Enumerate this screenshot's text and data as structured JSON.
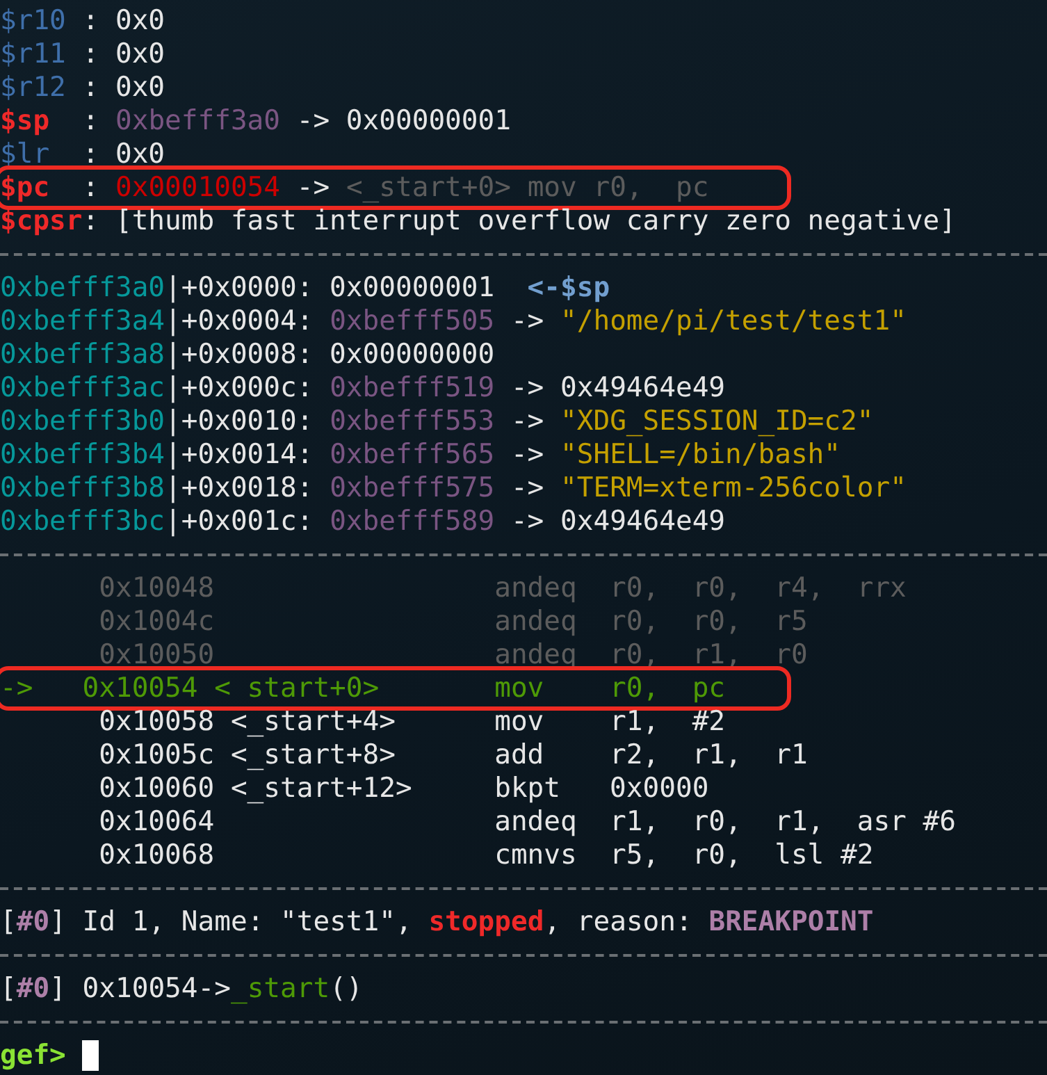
{
  "lines": [
    {
      "kind": "text",
      "boxed": false,
      "segments": [
        {
          "text": "$r10",
          "kind": "reg"
        },
        {
          "text": " : 0x0",
          "kind": "plain"
        }
      ]
    },
    {
      "kind": "text",
      "boxed": false,
      "segments": [
        {
          "text": "$r11",
          "kind": "reg"
        },
        {
          "text": " : 0x0",
          "kind": "plain"
        }
      ]
    },
    {
      "kind": "text",
      "boxed": false,
      "segments": [
        {
          "text": "$r12",
          "kind": "reg"
        },
        {
          "text": " : 0x0",
          "kind": "plain"
        }
      ]
    },
    {
      "kind": "text",
      "boxed": false,
      "segments": [
        {
          "text": "$sp",
          "kind": "changed"
        },
        {
          "text": "  : ",
          "kind": "plain"
        },
        {
          "text": "0xbefff3a0",
          "kind": "heap"
        },
        {
          "text": " -> 0x00000001",
          "kind": "plain"
        }
      ]
    },
    {
      "kind": "text",
      "boxed": false,
      "segments": [
        {
          "text": "$lr",
          "kind": "reg"
        },
        {
          "text": "  : 0x0",
          "kind": "plain"
        }
      ]
    },
    {
      "kind": "text",
      "boxed": true,
      "segments": [
        {
          "text": "$pc",
          "kind": "changed"
        },
        {
          "text": "  : ",
          "kind": "plain"
        },
        {
          "text": "0x00010054",
          "kind": "code"
        },
        {
          "text": " -> ",
          "kind": "plain"
        },
        {
          "text": "<_start+0> mov r0,  pc",
          "kind": "dim"
        }
      ]
    },
    {
      "kind": "text",
      "boxed": false,
      "segments": [
        {
          "text": "$cpsr",
          "kind": "changed"
        },
        {
          "text": ": [thumb fast interrupt overflow carry zero negative]",
          "kind": "plain"
        }
      ]
    },
    {
      "kind": "separator"
    },
    {
      "kind": "text",
      "boxed": false,
      "segments": [
        {
          "text": "0xbefff3a0",
          "kind": "stack"
        },
        {
          "text": "|+0x0000: 0x00000001  ",
          "kind": "plain"
        },
        {
          "text": "<-$sp",
          "kind": "marker"
        }
      ]
    },
    {
      "kind": "text",
      "boxed": false,
      "segments": [
        {
          "text": "0xbefff3a4",
          "kind": "stack"
        },
        {
          "text": "|+0x0004: ",
          "kind": "plain"
        },
        {
          "text": "0xbefff505",
          "kind": "heap"
        },
        {
          "text": " -> ",
          "kind": "plain"
        },
        {
          "text": "\"/home/pi/test/test1\"",
          "kind": "string"
        }
      ]
    },
    {
      "kind": "text",
      "boxed": false,
      "segments": [
        {
          "text": "0xbefff3a8",
          "kind": "stack"
        },
        {
          "text": "|+0x0008: 0x00000000",
          "kind": "plain"
        }
      ]
    },
    {
      "kind": "text",
      "boxed": false,
      "segments": [
        {
          "text": "0xbefff3ac",
          "kind": "stack"
        },
        {
          "text": "|+0x000c: ",
          "kind": "plain"
        },
        {
          "text": "0xbefff519",
          "kind": "heap"
        },
        {
          "text": " -> 0x49464e49",
          "kind": "plain"
        }
      ]
    },
    {
      "kind": "text",
      "boxed": false,
      "segments": [
        {
          "text": "0xbefff3b0",
          "kind": "stack"
        },
        {
          "text": "|+0x0010: ",
          "kind": "plain"
        },
        {
          "text": "0xbefff553",
          "kind": "heap"
        },
        {
          "text": " -> ",
          "kind": "plain"
        },
        {
          "text": "\"XDG_SESSION_ID=c2\"",
          "kind": "string"
        }
      ]
    },
    {
      "kind": "text",
      "boxed": false,
      "segments": [
        {
          "text": "0xbefff3b4",
          "kind": "stack"
        },
        {
          "text": "|+0x0014: ",
          "kind": "plain"
        },
        {
          "text": "0xbefff565",
          "kind": "heap"
        },
        {
          "text": " -> ",
          "kind": "plain"
        },
        {
          "text": "\"SHELL=/bin/bash\"",
          "kind": "string"
        }
      ]
    },
    {
      "kind": "text",
      "boxed": false,
      "segments": [
        {
          "text": "0xbefff3b8",
          "kind": "stack"
        },
        {
          "text": "|+0x0018: ",
          "kind": "plain"
        },
        {
          "text": "0xbefff575",
          "kind": "heap"
        },
        {
          "text": " -> ",
          "kind": "plain"
        },
        {
          "text": "\"TERM=xterm-256color\"",
          "kind": "string"
        }
      ]
    },
    {
      "kind": "text",
      "boxed": false,
      "segments": [
        {
          "text": "0xbefff3bc",
          "kind": "stack"
        },
        {
          "text": "|+0x001c: ",
          "kind": "plain"
        },
        {
          "text": "0xbefff589",
          "kind": "heap"
        },
        {
          "text": " -> 0x49464e49",
          "kind": "plain"
        }
      ]
    },
    {
      "kind": "separator"
    },
    {
      "kind": "text",
      "boxed": false,
      "segments": [
        {
          "text": "      0x10048                 andeq  r0,  r0,  r4,  rrx",
          "kind": "dim"
        }
      ]
    },
    {
      "kind": "text",
      "boxed": false,
      "segments": [
        {
          "text": "      0x1004c                 andeq  r0,  r0,  r5",
          "kind": "dim"
        }
      ]
    },
    {
      "kind": "text",
      "boxed": false,
      "segments": [
        {
          "text": "      0x10050                 andeq  r0,  r1,  r0",
          "kind": "dim"
        }
      ]
    },
    {
      "kind": "text",
      "boxed": true,
      "segments": [
        {
          "text": "->   0x10054 < start+0>       mov    r0,  pc",
          "kind": "current"
        }
      ]
    },
    {
      "kind": "text",
      "boxed": false,
      "segments": [
        {
          "text": "      0x10058 <_start+4>      mov    r1,  #2",
          "kind": "plain"
        }
      ]
    },
    {
      "kind": "text",
      "boxed": false,
      "segments": [
        {
          "text": "      0x1005c <_start+8>      add    r2,  r1,  r1",
          "kind": "plain"
        }
      ]
    },
    {
      "kind": "text",
      "boxed": false,
      "segments": [
        {
          "text": "      0x10060 <_start+12>     bkpt   0x0000",
          "kind": "plain"
        }
      ]
    },
    {
      "kind": "text",
      "boxed": false,
      "segments": [
        {
          "text": "      0x10064                 andeq  r1,  r0,  r1,  asr #6",
          "kind": "plain"
        }
      ]
    },
    {
      "kind": "text",
      "boxed": false,
      "segments": [
        {
          "text": "      0x10068                 cmnvs  r5,  r0,  lsl #2",
          "kind": "plain"
        }
      ]
    },
    {
      "kind": "separator"
    },
    {
      "kind": "text",
      "boxed": false,
      "segments": [
        {
          "text": "[",
          "kind": "plain"
        },
        {
          "text": "#0",
          "kind": "label"
        },
        {
          "text": "] Id 1, Name: \"test1\", ",
          "kind": "plain"
        },
        {
          "text": "stopped",
          "kind": "alert"
        },
        {
          "text": ", reason: ",
          "kind": "plain"
        },
        {
          "text": "BREAKPOINT",
          "kind": "label"
        }
      ]
    },
    {
      "kind": "separator"
    },
    {
      "kind": "text",
      "boxed": false,
      "segments": [
        {
          "text": "[",
          "kind": "plain"
        },
        {
          "text": "#0",
          "kind": "label"
        },
        {
          "text": "] 0x10054->",
          "kind": "plain"
        },
        {
          "text": "_start",
          "kind": "current"
        },
        {
          "text": "()",
          "kind": "plain"
        }
      ]
    },
    {
      "kind": "separator"
    },
    {
      "kind": "prompt",
      "cursor": true,
      "segments": [
        {
          "text": "gef>",
          "kind": "prompt"
        }
      ]
    }
  ]
}
